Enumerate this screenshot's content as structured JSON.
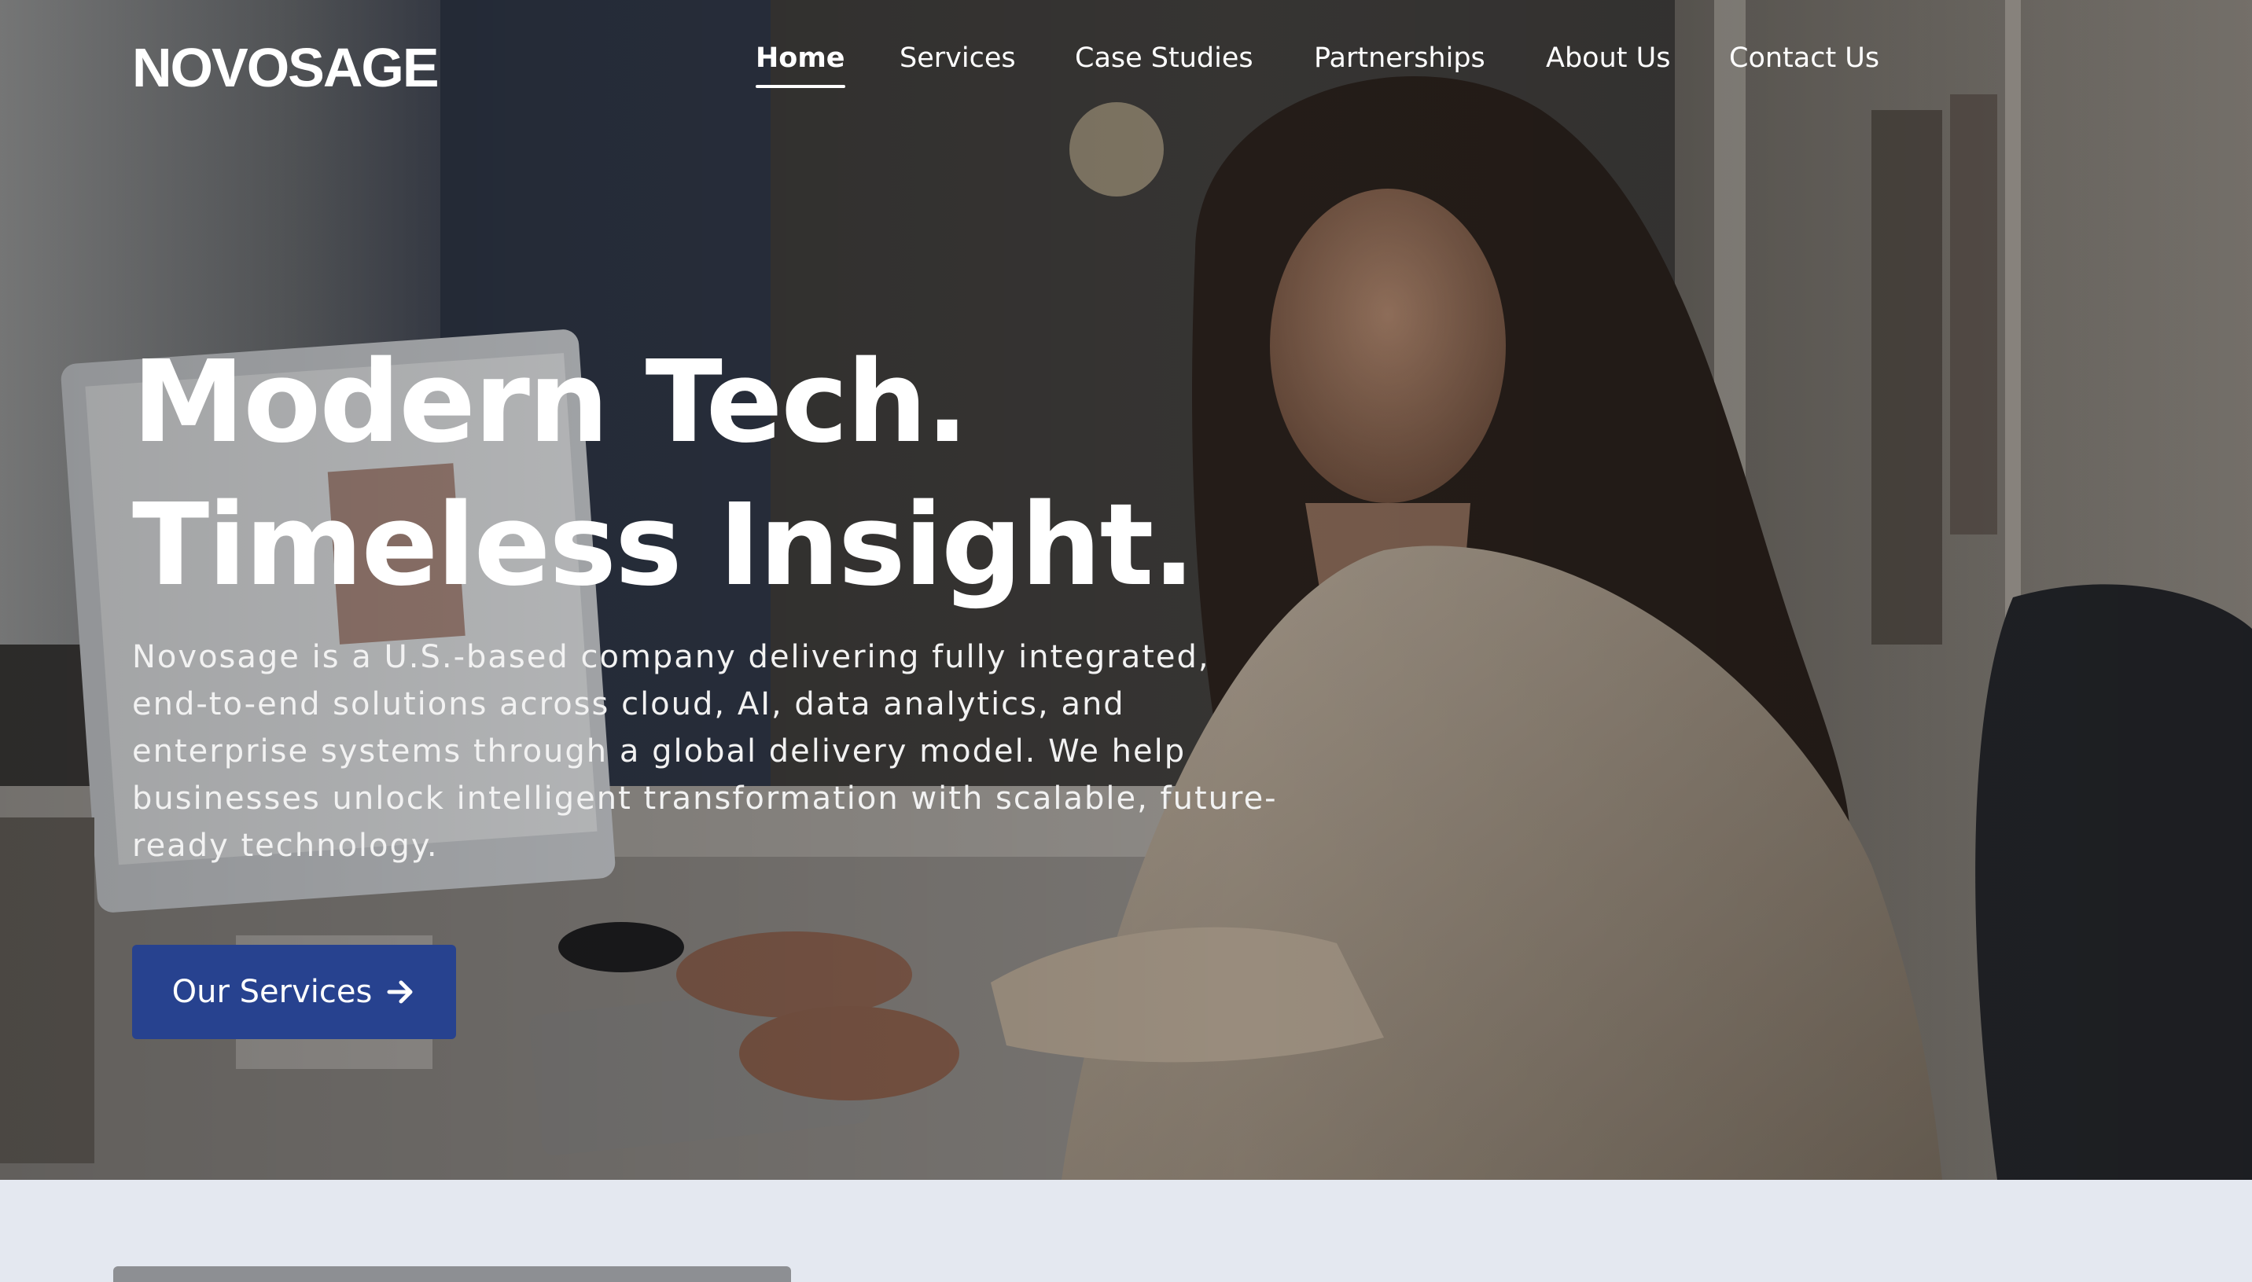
{
  "brand": {
    "logo_text": "NOVOSAGE"
  },
  "nav": {
    "items": [
      {
        "label": "Home",
        "active": true
      },
      {
        "label": "Services",
        "active": false
      },
      {
        "label": "Case Studies",
        "active": false
      },
      {
        "label": "Partnerships",
        "active": false
      },
      {
        "label": "About Us",
        "active": false
      },
      {
        "label": "Contact Us",
        "active": false
      }
    ]
  },
  "hero": {
    "headline_line1": "Modern Tech.",
    "headline_line2": "Timeless Insight.",
    "intro": "Novosage is a U.S.-based company delivering fully integrated, end-to-end solutions across cloud, AI, data analytics, and enterprise systems through a global delivery model. We help businesses unlock intelligent transformation with scalable, future-ready technology.",
    "cta_label": "Our Services",
    "cta_icon": "arrow-right-icon",
    "image_subject": "woman working at a desktop computer in an office"
  },
  "colors": {
    "cta_background": "#27428f",
    "text_on_hero": "#ffffff",
    "section_background": "#e4e8f0"
  }
}
